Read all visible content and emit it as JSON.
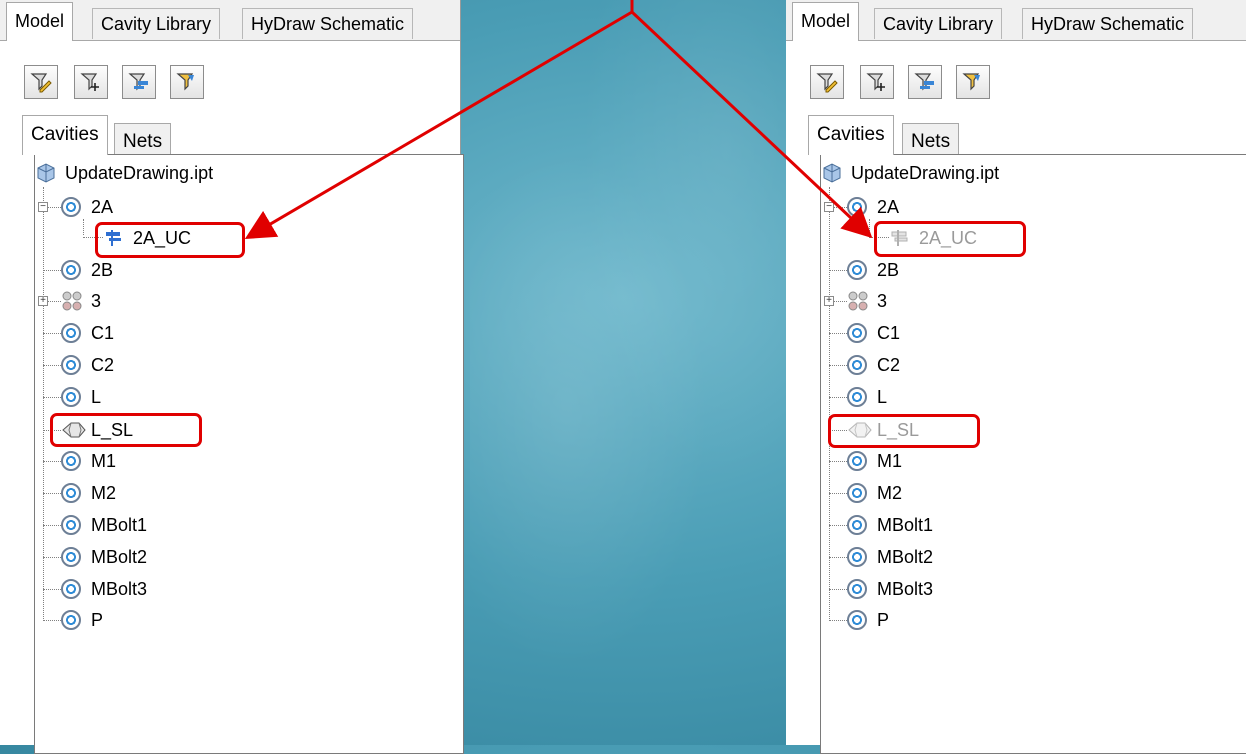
{
  "panels": [
    {
      "tabs": {
        "model": "Model",
        "cavity_library": "Cavity Library",
        "hydraw": "HyDraw Schematic"
      },
      "subtabs": {
        "cavities": "Cavities",
        "nets": "Nets"
      },
      "tree": {
        "root": "UpdateDrawing.ipt",
        "n2A": "2A",
        "n2A_UC": "2A_UC",
        "n2B": "2B",
        "n3": "3",
        "nC1": "C1",
        "nC2": "C2",
        "nL": "L",
        "nL_SL": "L_SL",
        "nM1": "M1",
        "nM2": "M2",
        "nMBolt1": "MBolt1",
        "nMBolt2": "MBolt2",
        "nMBolt3": "MBolt3",
        "nP": "P"
      }
    },
    {
      "tabs": {
        "model": "Model",
        "cavity_library": "Cavity Library",
        "hydraw": "HyDraw Schematic"
      },
      "subtabs": {
        "cavities": "Cavities",
        "nets": "Nets"
      },
      "tree": {
        "root": "UpdateDrawing.ipt",
        "n2A": "2A",
        "n2A_UC": "2A_UC",
        "n2B": "2B",
        "n3": "3",
        "nC1": "C1",
        "nC2": "C2",
        "nL": "L",
        "nL_SL": "L_SL",
        "nM1": "M1",
        "nM2": "M2",
        "nMBolt1": "MBolt1",
        "nMBolt2": "MBolt2",
        "nMBolt3": "MBolt3",
        "nP": "P"
      }
    }
  ],
  "annotation_color": "#e00000",
  "icons": [
    "edit-cavity-icon",
    "add-cavity-icon",
    "connection-icon",
    "update-icon",
    "part-file-icon",
    "cavity-icon",
    "unconnected-cavity-icon",
    "cavity-group-icon",
    "slot-icon"
  ]
}
